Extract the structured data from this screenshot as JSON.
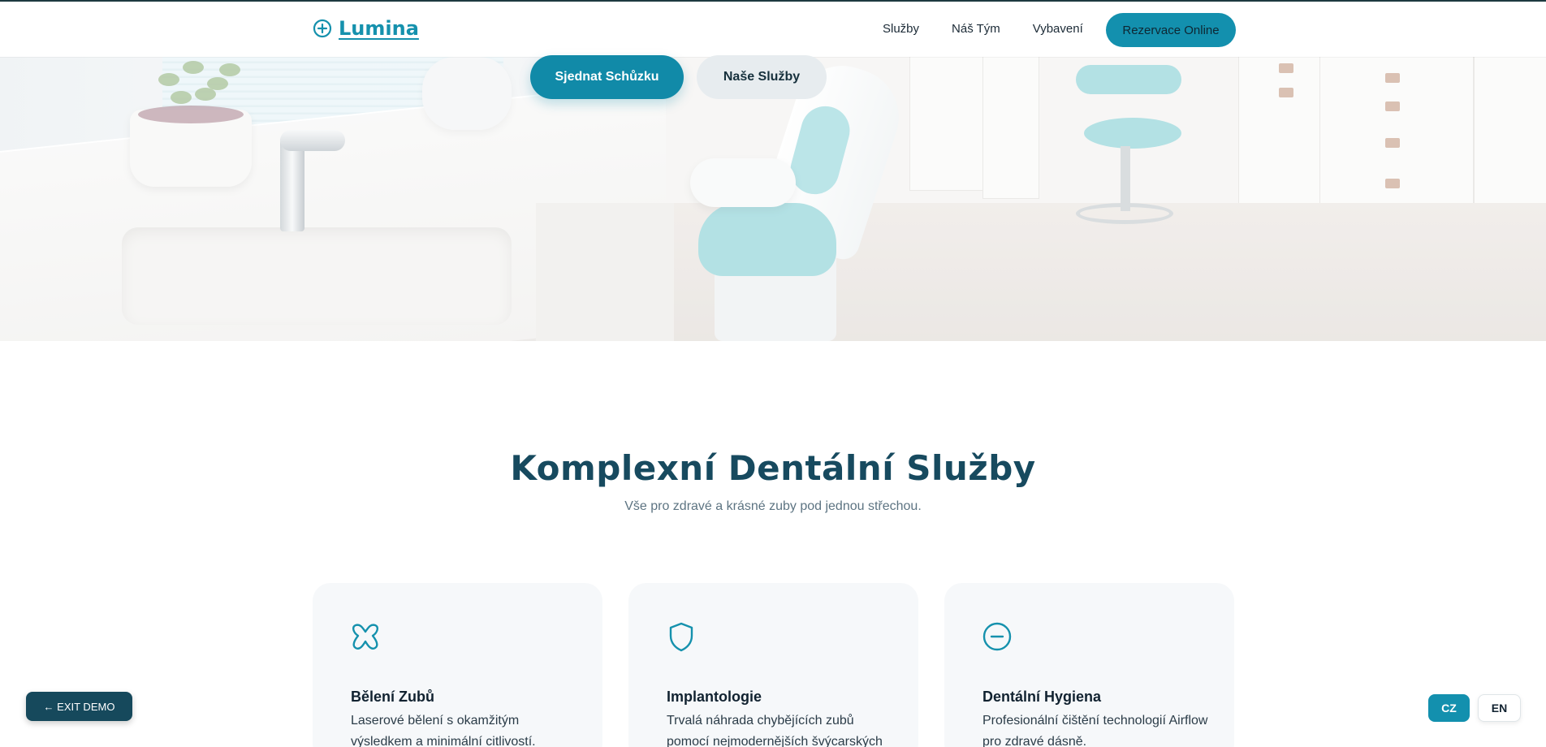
{
  "brand": {
    "name": "Lumina",
    "icon": "plus-circle-icon",
    "color": "#1591ad"
  },
  "nav": {
    "links": [
      "Služby",
      "Náš Tým",
      "Vybavení"
    ],
    "cta": "Rezervace Online"
  },
  "hero": {
    "image": "dental-office-photo",
    "primary_button": "Sjednat Schůzku",
    "secondary_button": "Naše Služby"
  },
  "services": {
    "title": "Komplexní Dentální Služby",
    "subtitle": "Vše pro zdravé a krásné zuby pod jednou střechou.",
    "cards": [
      {
        "icon": "tooth-icon",
        "title": "Bělení Zubů",
        "text": "Laserové bělení s okamžitým výsledkem a minimální citlivostí."
      },
      {
        "icon": "shield-icon",
        "title": "Implantologie",
        "text": "Trvalá náhrada chybějících zubů pomocí nejmodernějších švýcarských"
      },
      {
        "icon": "minus-circle-icon",
        "title": "Dentální Hygiena",
        "text": "Profesionální čištění technologií Airflow pro zdravé dásně."
      }
    ]
  },
  "controls": {
    "exit_demo": "← EXIT DEMO",
    "lang_cz": "CZ",
    "lang_en": "EN",
    "active_lang": "CZ"
  },
  "colors": {
    "accent": "#1390ae",
    "heading": "#174a5f",
    "dark_button": "#16495c"
  }
}
